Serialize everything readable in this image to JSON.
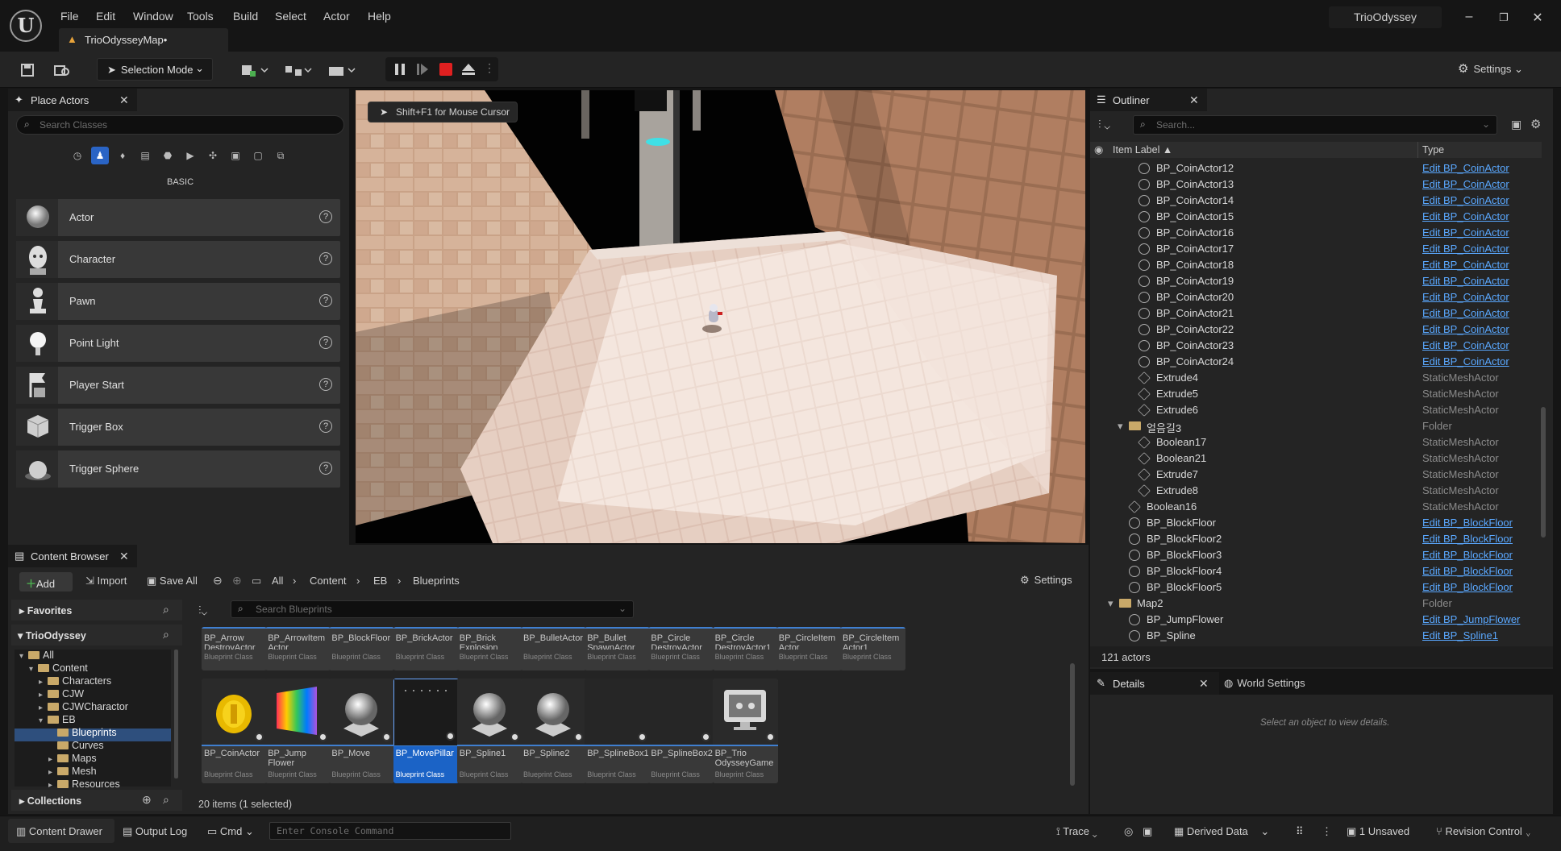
{
  "app": {
    "project_name": "TrioOdyssey",
    "map_tab": "TrioOdysseyMap•",
    "logo_letter": "U"
  },
  "menu": [
    "File",
    "Edit",
    "Window",
    "Tools",
    "Build",
    "Select",
    "Actor",
    "Help"
  ],
  "toolbar": {
    "selection_mode": "Selection Mode",
    "settings": "Settings"
  },
  "place_actors": {
    "title": "Place Actors",
    "search_placeholder": "Search Classes",
    "category_label": "BASIC",
    "items": [
      "Actor",
      "Character",
      "Pawn",
      "Point Light",
      "Player Start",
      "Trigger Box",
      "Trigger Sphere"
    ]
  },
  "viewport": {
    "hint": "Shift+F1 for Mouse Cursor"
  },
  "outliner": {
    "title": "Outliner",
    "search_placeholder": "Search...",
    "col_label": "Item Label",
    "col_type": "Type",
    "actor_count": "121 actors",
    "rows": [
      {
        "name": "BP_CoinActor12",
        "type": "Edit BP_CoinActor",
        "kind": "link",
        "indent": 2
      },
      {
        "name": "BP_CoinActor13",
        "type": "Edit BP_CoinActor",
        "kind": "link",
        "indent": 2
      },
      {
        "name": "BP_CoinActor14",
        "type": "Edit BP_CoinActor",
        "kind": "link",
        "indent": 2
      },
      {
        "name": "BP_CoinActor15",
        "type": "Edit BP_CoinActor",
        "kind": "link",
        "indent": 2
      },
      {
        "name": "BP_CoinActor16",
        "type": "Edit BP_CoinActor",
        "kind": "link",
        "indent": 2
      },
      {
        "name": "BP_CoinActor17",
        "type": "Edit BP_CoinActor",
        "kind": "link",
        "indent": 2
      },
      {
        "name": "BP_CoinActor18",
        "type": "Edit BP_CoinActor",
        "kind": "link",
        "indent": 2
      },
      {
        "name": "BP_CoinActor19",
        "type": "Edit BP_CoinActor",
        "kind": "link",
        "indent": 2
      },
      {
        "name": "BP_CoinActor20",
        "type": "Edit BP_CoinActor",
        "kind": "link",
        "indent": 2
      },
      {
        "name": "BP_CoinActor21",
        "type": "Edit BP_CoinActor",
        "kind": "link",
        "indent": 2
      },
      {
        "name": "BP_CoinActor22",
        "type": "Edit BP_CoinActor",
        "kind": "link",
        "indent": 2
      },
      {
        "name": "BP_CoinActor23",
        "type": "Edit BP_CoinActor",
        "kind": "link",
        "indent": 2
      },
      {
        "name": "BP_CoinActor24",
        "type": "Edit BP_CoinActor",
        "kind": "link",
        "indent": 2
      },
      {
        "name": "Extrude4",
        "type": "StaticMeshActor",
        "kind": "mesh",
        "indent": 2
      },
      {
        "name": "Extrude5",
        "type": "StaticMeshActor",
        "kind": "mesh",
        "indent": 2
      },
      {
        "name": "Extrude6",
        "type": "StaticMeshActor",
        "kind": "mesh",
        "indent": 2
      },
      {
        "name": "얼음길3",
        "type": "Folder",
        "kind": "folder",
        "indent": 1
      },
      {
        "name": "Boolean17",
        "type": "StaticMeshActor",
        "kind": "mesh",
        "indent": 2
      },
      {
        "name": "Boolean21",
        "type": "StaticMeshActor",
        "kind": "mesh",
        "indent": 2
      },
      {
        "name": "Extrude7",
        "type": "StaticMeshActor",
        "kind": "mesh",
        "indent": 2
      },
      {
        "name": "Extrude8",
        "type": "StaticMeshActor",
        "kind": "mesh",
        "indent": 2
      },
      {
        "name": "Boolean16",
        "type": "StaticMeshActor",
        "kind": "mesh",
        "indent": 1
      },
      {
        "name": "BP_BlockFloor",
        "type": "Edit BP_BlockFloor",
        "kind": "link",
        "indent": 1
      },
      {
        "name": "BP_BlockFloor2",
        "type": "Edit BP_BlockFloor",
        "kind": "link",
        "indent": 1
      },
      {
        "name": "BP_BlockFloor3",
        "type": "Edit BP_BlockFloor",
        "kind": "link",
        "indent": 1
      },
      {
        "name": "BP_BlockFloor4",
        "type": "Edit BP_BlockFloor",
        "kind": "link",
        "indent": 1
      },
      {
        "name": "BP_BlockFloor5",
        "type": "Edit BP_BlockFloor",
        "kind": "link",
        "indent": 1
      },
      {
        "name": "Map2",
        "type": "Folder",
        "kind": "folder",
        "indent": 0
      },
      {
        "name": "BP_JumpFlower",
        "type": "Edit BP_JumpFlower",
        "kind": "link",
        "indent": 1
      },
      {
        "name": "BP_Spline",
        "type": "Edit BP_Spline1",
        "kind": "link",
        "indent": 1
      }
    ]
  },
  "details": {
    "title": "Details",
    "world_settings": "World Settings",
    "empty_msg": "Select an object to view details."
  },
  "content_browser": {
    "title": "Content Browser",
    "add": "Add",
    "import": "Import",
    "save_all": "Save All",
    "settings": "Settings",
    "breadcrumb": [
      "All",
      "Content",
      "EB",
      "Blueprints"
    ],
    "search_placeholder": "Search Blueprints",
    "favorites": "Favorites",
    "project": "TrioOdyssey",
    "collections": "Collections",
    "tree": [
      {
        "label": "All",
        "depth": 0
      },
      {
        "label": "Content",
        "depth": 1
      },
      {
        "label": "Characters",
        "depth": 2
      },
      {
        "label": "CJW",
        "depth": 2
      },
      {
        "label": "CJWCharactor",
        "depth": 2
      },
      {
        "label": "EB",
        "depth": 2
      },
      {
        "label": "Blueprints",
        "depth": 3
      },
      {
        "label": "Curves",
        "depth": 3
      },
      {
        "label": "Maps",
        "depth": 3
      },
      {
        "label": "Mesh",
        "depth": 3
      },
      {
        "label": "Resources",
        "depth": 3
      }
    ],
    "items_row1": [
      [
        "BP_Arrow",
        "DestroyActor"
      ],
      [
        "BP_ArrowItem",
        "Actor"
      ],
      [
        "BP_BlockFloor",
        ""
      ],
      [
        "BP_BrickActor",
        ""
      ],
      [
        "BP_Brick",
        "Explosion"
      ],
      [
        "BP_BulletActor",
        ""
      ],
      [
        "BP_Bullet",
        "SpawnActor"
      ],
      [
        "BP_Circle",
        "DestroyActor"
      ],
      [
        "BP_Circle",
        "DestroyActor1"
      ],
      [
        "BP_CircleItem",
        "Actor"
      ],
      [
        "BP_CircleItem",
        "Actor1"
      ]
    ],
    "items_row2": [
      [
        "BP_CoinActor",
        ""
      ],
      [
        "BP_Jump",
        "Flower"
      ],
      [
        "BP_Move",
        ""
      ],
      [
        "BP_MovePillar",
        ""
      ],
      [
        "BP_Spline1",
        ""
      ],
      [
        "BP_Spline2",
        ""
      ],
      [
        "BP_SplineBox1",
        ""
      ],
      [
        "BP_SplineBox2",
        ""
      ],
      [
        "BP_Trio",
        "OdysseyGame"
      ]
    ],
    "class_label": "Blueprint Class",
    "status": "20 items (1 selected)"
  },
  "statusbar": {
    "content_drawer": "Content Drawer",
    "output_log": "Output Log",
    "cmd": "Cmd",
    "console_placeholder": "Enter Console Command",
    "trace": "Trace",
    "derived_data": "Derived Data",
    "unsaved": "1 Unsaved",
    "revision_control": "Revision Control"
  },
  "colors": {
    "accent": "#1b63c6",
    "link": "#5aa8ff",
    "folder": "#c9a969",
    "stop": "#e02020"
  }
}
